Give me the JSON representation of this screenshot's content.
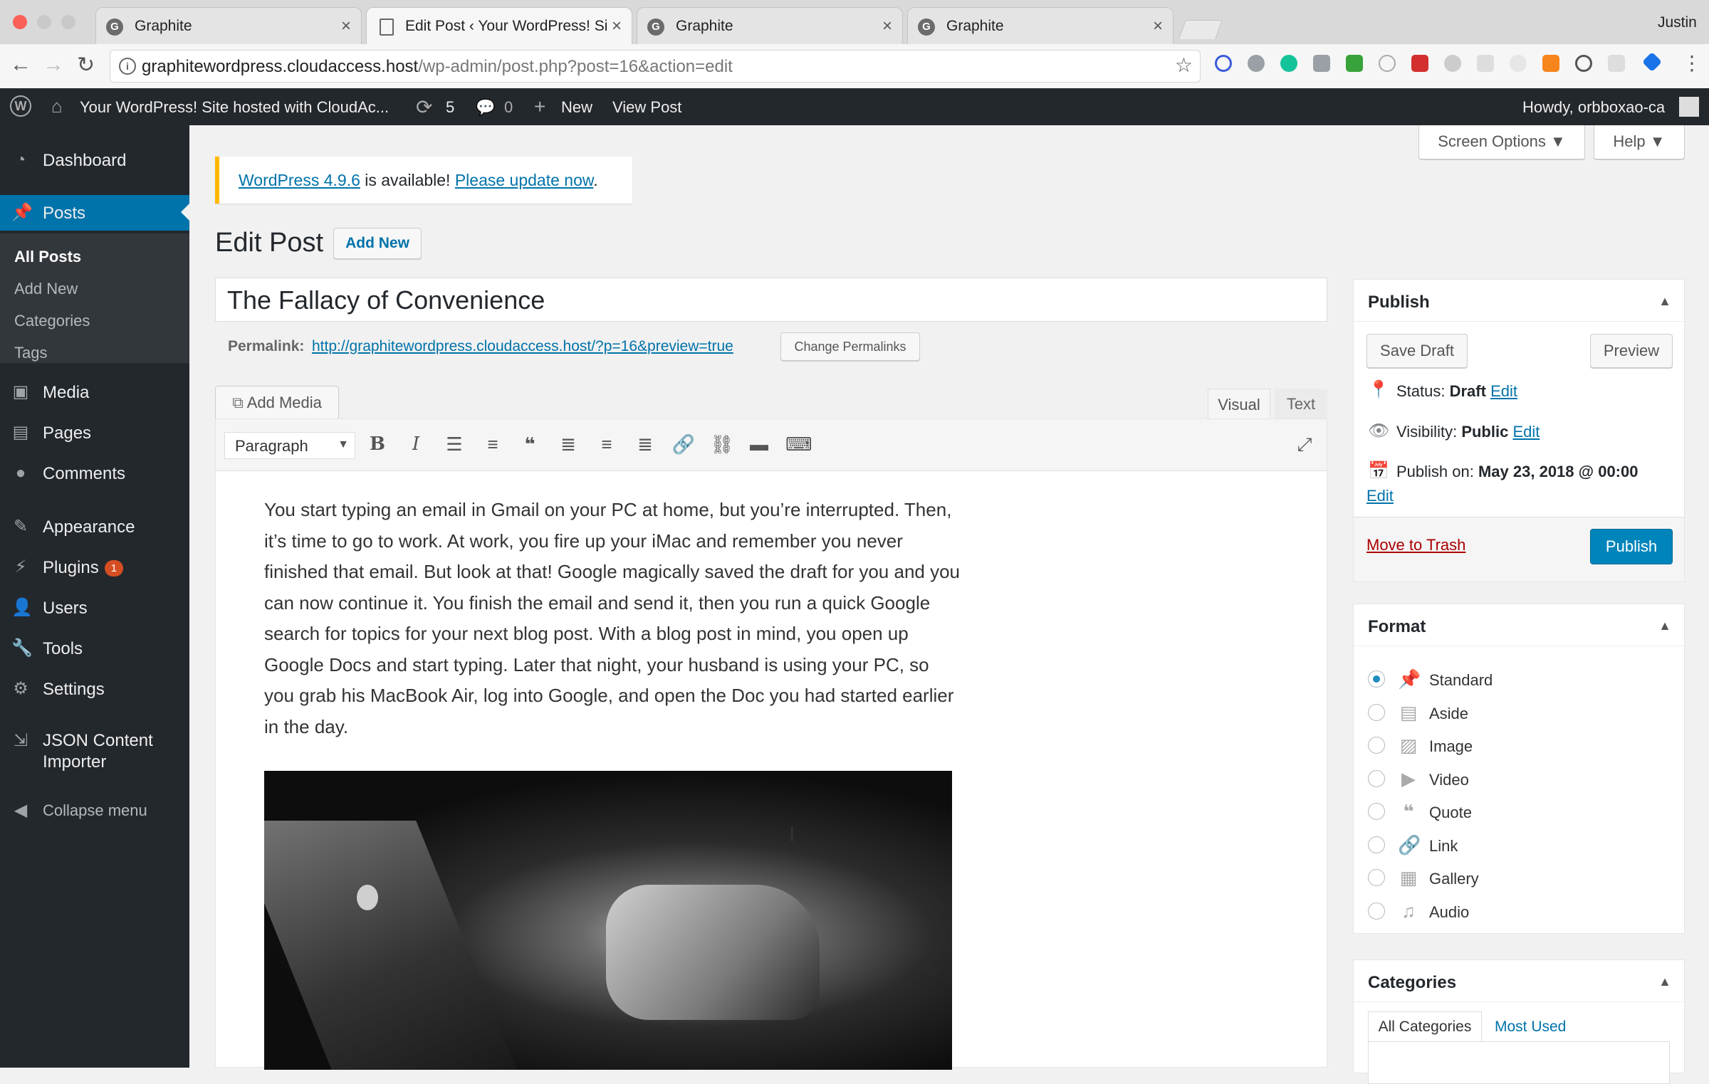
{
  "browser": {
    "tabs": [
      {
        "title": "Graphite",
        "active": false
      },
      {
        "title": "Edit Post ‹ Your WordPress! Si",
        "active": true
      },
      {
        "title": "Graphite",
        "active": false
      },
      {
        "title": "Graphite",
        "active": false
      }
    ],
    "profile_name": "Justin",
    "url_host": "graphitewordpress.cloudaccess.host",
    "url_path": "/wp-admin/post.php?post=16&action=edit"
  },
  "admin_bar": {
    "site_name": "Your WordPress! Site hosted with CloudAc...",
    "updates_count": "5",
    "comments_count": "0",
    "new_label": "New",
    "view_post_label": "View Post",
    "howdy": "Howdy, orbboxao-ca"
  },
  "sidebar": {
    "items": [
      {
        "label": "Dashboard",
        "icon": "dashboard-icon"
      },
      {
        "label": "Posts",
        "icon": "pin-icon"
      },
      {
        "label": "Media",
        "icon": "media-icon"
      },
      {
        "label": "Pages",
        "icon": "pages-icon"
      },
      {
        "label": "Comments",
        "icon": "comment-icon"
      },
      {
        "label": "Appearance",
        "icon": "brush-icon"
      },
      {
        "label": "Plugins",
        "icon": "plugin-icon",
        "badge": "1"
      },
      {
        "label": "Users",
        "icon": "user-icon"
      },
      {
        "label": "Tools",
        "icon": "wrench-icon"
      },
      {
        "label": "Settings",
        "icon": "settings-icon"
      },
      {
        "label": "JSON Content",
        "label2": "Importer",
        "icon": "import-icon"
      },
      {
        "label": "Collapse menu",
        "icon": "collapse-icon"
      }
    ],
    "submenu": [
      "All Posts",
      "Add New",
      "Categories",
      "Tags"
    ]
  },
  "screen_meta": {
    "screen_options": "Screen Options",
    "help": "Help"
  },
  "notice": {
    "version_link": "WordPress 4.9.6",
    "middle": " is available! ",
    "update_link": "Please update now",
    "end": "."
  },
  "page": {
    "heading": "Edit Post",
    "add_new": "Add New",
    "post_title": "The Fallacy of Convenience",
    "permalink_label": "Permalink:",
    "permalink_url": "http://graphitewordpress.cloudaccess.host/?p=16&preview=true",
    "change_permalinks": "Change Permalinks",
    "add_media": "Add Media",
    "tab_visual": "Visual",
    "tab_text": "Text",
    "format_select": "Paragraph",
    "content": "You start typing an email in Gmail on your PC at home, but you’re interrupted. Then, it’s time to go to work. At work, you fire up your iMac and remember you never finished that email. But look at that! Google magically saved the draft for you and you can now continue it. You finish the email and send it, then you run a quick Google search for topics for your next blog post. With a blog post in mind, you open up Google Docs and start typing. Later that night, your husband is using your PC, so you grab his MacBook Air, log into Google, and open the Doc you had started earlier in the day."
  },
  "publish_box": {
    "title": "Publish",
    "save_draft": "Save Draft",
    "preview": "Preview",
    "status_label": "Status:",
    "status_value": "Draft",
    "visibility_label": "Visibility:",
    "visibility_value": "Public",
    "publish_on_label": "Publish on:",
    "publish_on_value": "May 23, 2018 @ 00:00",
    "edit": "Edit",
    "move_to_trash": "Move to Trash",
    "publish": "Publish"
  },
  "format_box": {
    "title": "Format",
    "options": [
      {
        "label": "Standard",
        "icon": "pin-icon",
        "selected": true
      },
      {
        "label": "Aside",
        "icon": "aside-icon",
        "selected": false
      },
      {
        "label": "Image",
        "icon": "image-icon",
        "selected": false
      },
      {
        "label": "Video",
        "icon": "video-icon",
        "selected": false
      },
      {
        "label": "Quote",
        "icon": "quote-icon",
        "selected": false
      },
      {
        "label": "Link",
        "icon": "link-icon",
        "selected": false
      },
      {
        "label": "Gallery",
        "icon": "gallery-icon",
        "selected": false
      },
      {
        "label": "Audio",
        "icon": "audio-icon",
        "selected": false
      }
    ]
  },
  "categories_box": {
    "title": "Categories",
    "tab_all": "All Categories",
    "tab_most_used": "Most Used"
  },
  "colors": {
    "accent": "#0073aa",
    "sidebar": "#23282d",
    "notice": "#ffb900",
    "badge": "#d54e21"
  }
}
